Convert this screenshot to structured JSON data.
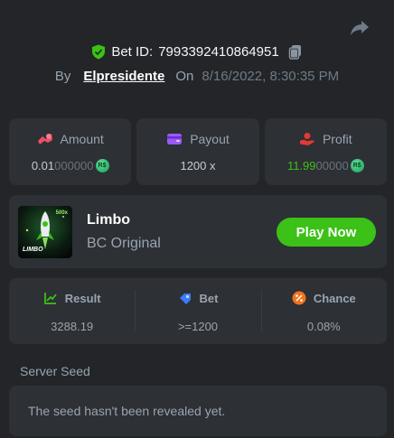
{
  "header": {
    "bet_id_label": "Bet ID:",
    "bet_id": "7993392410864951",
    "by_label": "By",
    "username": "Elpresidente",
    "on_label": "On",
    "date": "8/16/2022, 8:30:35 PM"
  },
  "stats": {
    "amount": {
      "label": "Amount",
      "value_main": "0.01",
      "value_dim": "000000",
      "icon": "amount-icon",
      "color": "#ec4f64"
    },
    "payout": {
      "label": "Payout",
      "value": "1200 x",
      "icon": "wallet-icon",
      "color": "#9b59f5"
    },
    "profit": {
      "label": "Profit",
      "value_main": "11.99",
      "value_dim": "00000",
      "icon": "profit-icon",
      "color": "#e53935"
    },
    "currency_badge": "R$"
  },
  "game": {
    "name": "Limbo",
    "provider": "BC Original",
    "thumb_text": "LIMBO",
    "thumb_badge": "500x",
    "play_label": "Play Now",
    "accent": "#3bc117"
  },
  "details": {
    "result": {
      "label": "Result",
      "value": "3288.19"
    },
    "bet": {
      "label": "Bet",
      "value": ">=1200"
    },
    "chance": {
      "label": "Chance",
      "value": "0.08%"
    }
  },
  "seed": {
    "label": "Server Seed",
    "message": "The seed hasn't been revealed yet."
  }
}
